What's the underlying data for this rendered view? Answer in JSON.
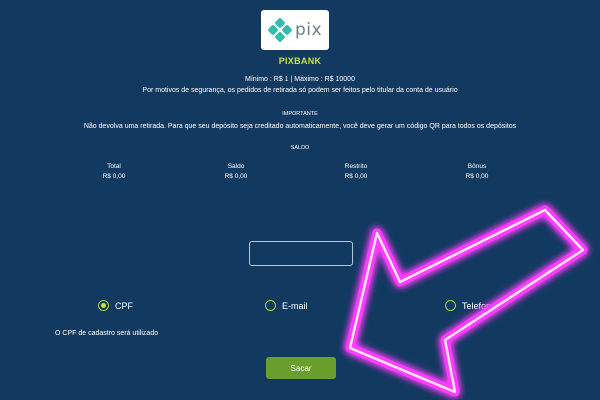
{
  "logo": {
    "word": "pix",
    "icon": "pix-diamond-icon",
    "color": "#32bcad"
  },
  "brand": "PIXBANK",
  "limits": "Mínimo : R$ 1 | Máximo : R$ 10000",
  "security_notice": "Por motivos de segurança, os pedidos de retirada só podem ser feitos pelo titular da conta de usuário",
  "important_heading": "IMPORTANTE",
  "important_text": "Não devolva uma retirada. Para que seu depósito seja creditado automaticamente, você deve gerar um código QR para todos os depósitos",
  "balance_heading": "SALDO",
  "balances": [
    {
      "label": "Total",
      "value": "R$ 0,00"
    },
    {
      "label": "Saldo",
      "value": "R$ 0,00"
    },
    {
      "label": "Restrito",
      "value": "R$ 0,00"
    },
    {
      "label": "Bônus",
      "value": "R$ 0,00"
    }
  ],
  "amount_input": {
    "value": "",
    "placeholder": ""
  },
  "key_types": [
    {
      "label": "CPF",
      "selected": true
    },
    {
      "label": "E-mail",
      "selected": false
    },
    {
      "label": "Telefone",
      "selected": false
    }
  ],
  "cpf_note": "O CPF de cadastro será utilizado",
  "submit_label": "Sacar",
  "colors": {
    "background": "#123a60",
    "accent": "#c7e43a",
    "button": "#6a9e2d",
    "arrow": "#ff3dff"
  }
}
